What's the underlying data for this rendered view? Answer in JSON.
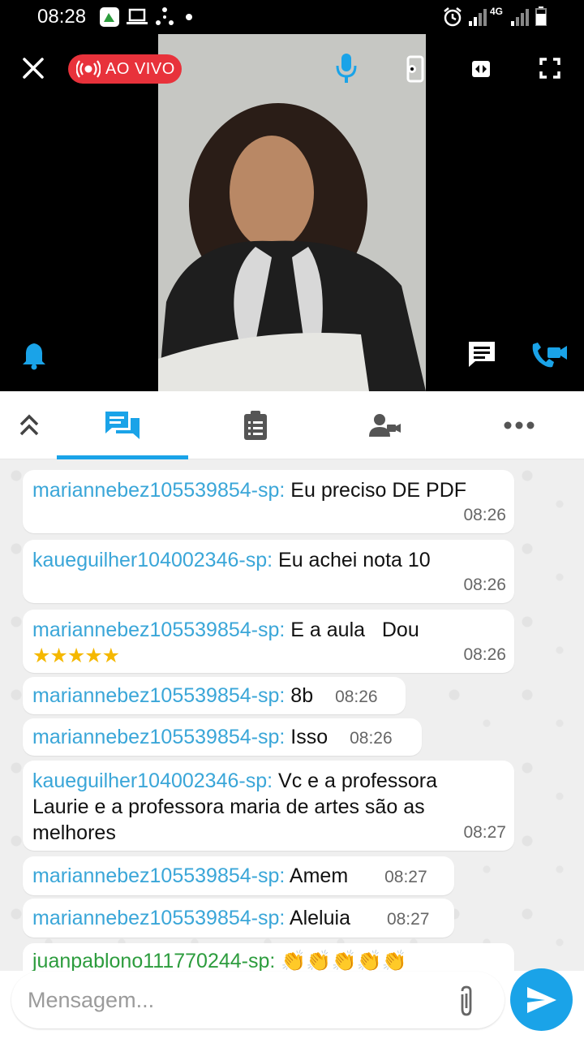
{
  "status_bar": {
    "time": "08:28",
    "network_label": "4G"
  },
  "live": {
    "label": "AO VIVO",
    "color": "#e8323b"
  },
  "accent_color": "#1aa3e8",
  "video": {
    "icons": [
      "close-icon",
      "microphone-icon",
      "screen-settings-icon",
      "switch-camera-icon",
      "fullscreen-icon",
      "bell-icon",
      "chat-icon",
      "video-call-icon"
    ]
  },
  "tabs": [
    {
      "name": "collapse",
      "icon": "double-chevron-up-icon"
    },
    {
      "name": "chat",
      "icon": "chat-bubbles-icon",
      "active": true
    },
    {
      "name": "notes",
      "icon": "clipboard-icon"
    },
    {
      "name": "participants",
      "icon": "person-video-icon"
    },
    {
      "name": "more",
      "icon": "more-dots-icon"
    }
  ],
  "messages": [
    {
      "user": "mariannebez105539854-sp:",
      "text": "Eu preciso DE PDF",
      "time": "08:26"
    },
    {
      "user": "kaueguilher104002346-sp:",
      "text": "Eu achei nota 10",
      "time": "08:26"
    },
    {
      "user": "mariannebez105539854-sp:",
      "text": "E a aula   Dou",
      "stars": "★★★★★",
      "time": "08:26"
    },
    {
      "user": "mariannebez105539854-sp:",
      "text": "8b",
      "time": "08:26"
    },
    {
      "user": "mariannebez105539854-sp:",
      "text": "Isso",
      "time": "08:26"
    },
    {
      "user": "kaueguilher104002346-sp:",
      "text": "Vc e a professora",
      "text2": "Laurie e a professora maria de artes são as",
      "text3": "melhores",
      "time": "08:27"
    },
    {
      "user": "mariannebez105539854-sp:",
      "text": "Amem",
      "time": "08:27"
    },
    {
      "user": "mariannebez105539854-sp:",
      "text": "Aleluia",
      "time": "08:27"
    },
    {
      "user": "juanpablono111770244-sp:",
      "text": "👏👏👏👏👏"
    }
  ],
  "composer": {
    "placeholder": "Mensagem..."
  }
}
